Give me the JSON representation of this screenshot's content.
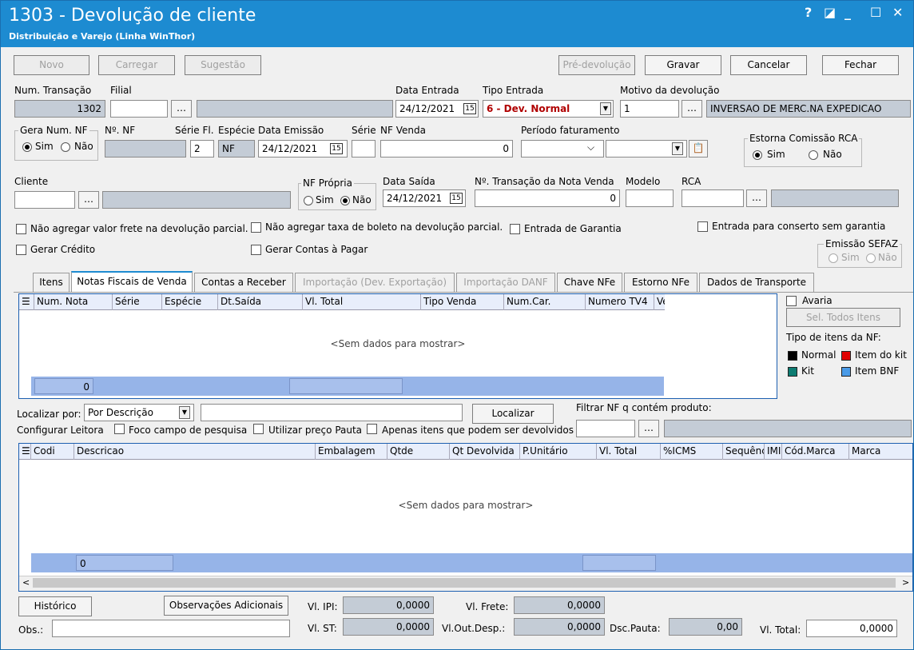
{
  "window": {
    "title": "1303 - Devolução de cliente",
    "subtitle": "Distribuição e Varejo (Linha WinThor)",
    "ctrl_help": "?",
    "ctrl_mini": "◪",
    "ctrl_min": "_",
    "ctrl_max": "☐",
    "ctrl_close": "✕"
  },
  "toolbar": {
    "novo": "Novo",
    "carregar": "Carregar",
    "sugestao": "Sugestão",
    "pre_devolucao": "Pré-devolução",
    "gravar": "Gravar",
    "cancelar": "Cancelar",
    "fechar": "Fechar"
  },
  "row1": {
    "num_transacao_label": "Num. Transação",
    "num_transacao": "1302",
    "filial_label": "Filial",
    "filial": "",
    "data_entrada_label": "Data Entrada",
    "data_entrada": "24/12/2021",
    "tipo_entrada_label": "Tipo Entrada",
    "tipo_entrada": "6 - Dev. Normal",
    "motivo_label": "Motivo da devolução",
    "motivo_cod": "1",
    "motivo_desc": "INVERSAO DE MERC.NA EXPEDICAO"
  },
  "row2": {
    "gera_num_nf_label": "Gera Num. NF",
    "sim": "Sim",
    "nao": "Não",
    "num_nf_label": "Nº. NF",
    "serie_fl_label": "Série Fl.",
    "serie_fl": "2",
    "especie_label": "Espécie",
    "especie": "NF",
    "data_emissao_label": "Data Emissão",
    "data_emissao": "24/12/2021",
    "serie_label": "Série",
    "nf_venda_label": "NF Venda",
    "nf_venda": "0",
    "periodo_label": "Período faturamento",
    "estorna_label": "Estorna Comissão RCA",
    "estorna_sim": "Sim",
    "estorna_nao": "Não"
  },
  "row3": {
    "cliente_label": "Cliente",
    "nf_propria_label": "NF Própria",
    "sim": "Sim",
    "nao": "Não",
    "data_saida_label": "Data Saída",
    "data_saida": "24/12/2021",
    "num_trans_nota_label": "Nº. Transação da Nota Venda",
    "num_trans_nota": "0",
    "modelo_label": "Modelo",
    "rca_label": "RCA"
  },
  "checks": {
    "nao_agregar_frete": "Não agregar valor frete na devolução parcial.",
    "nao_agregar_boleto": "Não agregar taxa de boleto na devolução parcial.",
    "entrada_garantia": "Entrada de Garantia",
    "entrada_conserto": "Entrada para conserto sem garantia",
    "gerar_credito": "Gerar Crédito",
    "gerar_contas": "Gerar Contas à Pagar",
    "emissao_sefaz_label": "Emissão SEFAZ",
    "sefaz_sim": "Sim",
    "sefaz_nao": "Não"
  },
  "tabs": [
    "Itens",
    "Notas Fiscais de Venda",
    "Contas a Receber",
    "Importação (Dev. Exportação)",
    "Importação DANF",
    "Chave NFe",
    "Estorno NFe",
    "Dados de Transporte"
  ],
  "grid1": {
    "columns": [
      "Num. Nota",
      "Série",
      "Espécie",
      "Dt.Saída",
      "Vl. Total",
      "Tipo Venda",
      "Num.Car.",
      "Numero TV4",
      "Ver"
    ],
    "empty": "<Sem dados para mostrar>",
    "footer_count": "0"
  },
  "side": {
    "avaria": "Avaria",
    "sel_todos": "Sel. Todos Itens",
    "tipo_itens_label": "Tipo de itens da NF:",
    "normal": "Normal",
    "item_kit": "Item do kit",
    "kit": "Kit",
    "item_bnf": "Item BNF",
    "c_normal": "#000000",
    "c_item_kit": "#e00000",
    "c_kit": "#0d7c72",
    "c_item_bnf": "#4a9be8"
  },
  "search": {
    "localizar_por_label": "Localizar por:",
    "localizar_por": "Por Descrição",
    "localizar_btn": "Localizar",
    "filtrar_label": "Filtrar NF q contém produto:",
    "configurar_leitora": "Configurar Leitora",
    "foco_campo": "Foco campo de pesquisa",
    "utilizar_preco": "Utilizar preço Pauta",
    "apenas_itens": "Apenas itens que podem ser devolvidos"
  },
  "grid2": {
    "columns": [
      "Codi",
      "Descricao",
      "Embalagem",
      "Qtde",
      "Qt Devolvida",
      "P.Unitário",
      "Vl. Total",
      "%ICMS",
      "Sequênc",
      "IMI",
      "Cód.Marca",
      "Marca"
    ],
    "empty": "<Sem dados para mostrar>",
    "footer_count": "0"
  },
  "bottom": {
    "historico": "Histórico",
    "observacoes": "Observações Adicionais",
    "vl_ipi_label": "Vl. IPI:",
    "vl_ipi": "0,0000",
    "vl_frete_label": "Vl. Frete:",
    "vl_frete": "0,0000",
    "obs_label": "Obs.:",
    "vl_st_label": "Vl. ST:",
    "vl_st": "0,0000",
    "vl_out_label": "Vl.Out.Desp.:",
    "vl_out": "0,0000",
    "dsc_pauta_label": "Dsc.Pauta:",
    "dsc_pauta": "0,00",
    "vl_total_label": "Vl. Total:",
    "vl_total": "0,0000"
  }
}
